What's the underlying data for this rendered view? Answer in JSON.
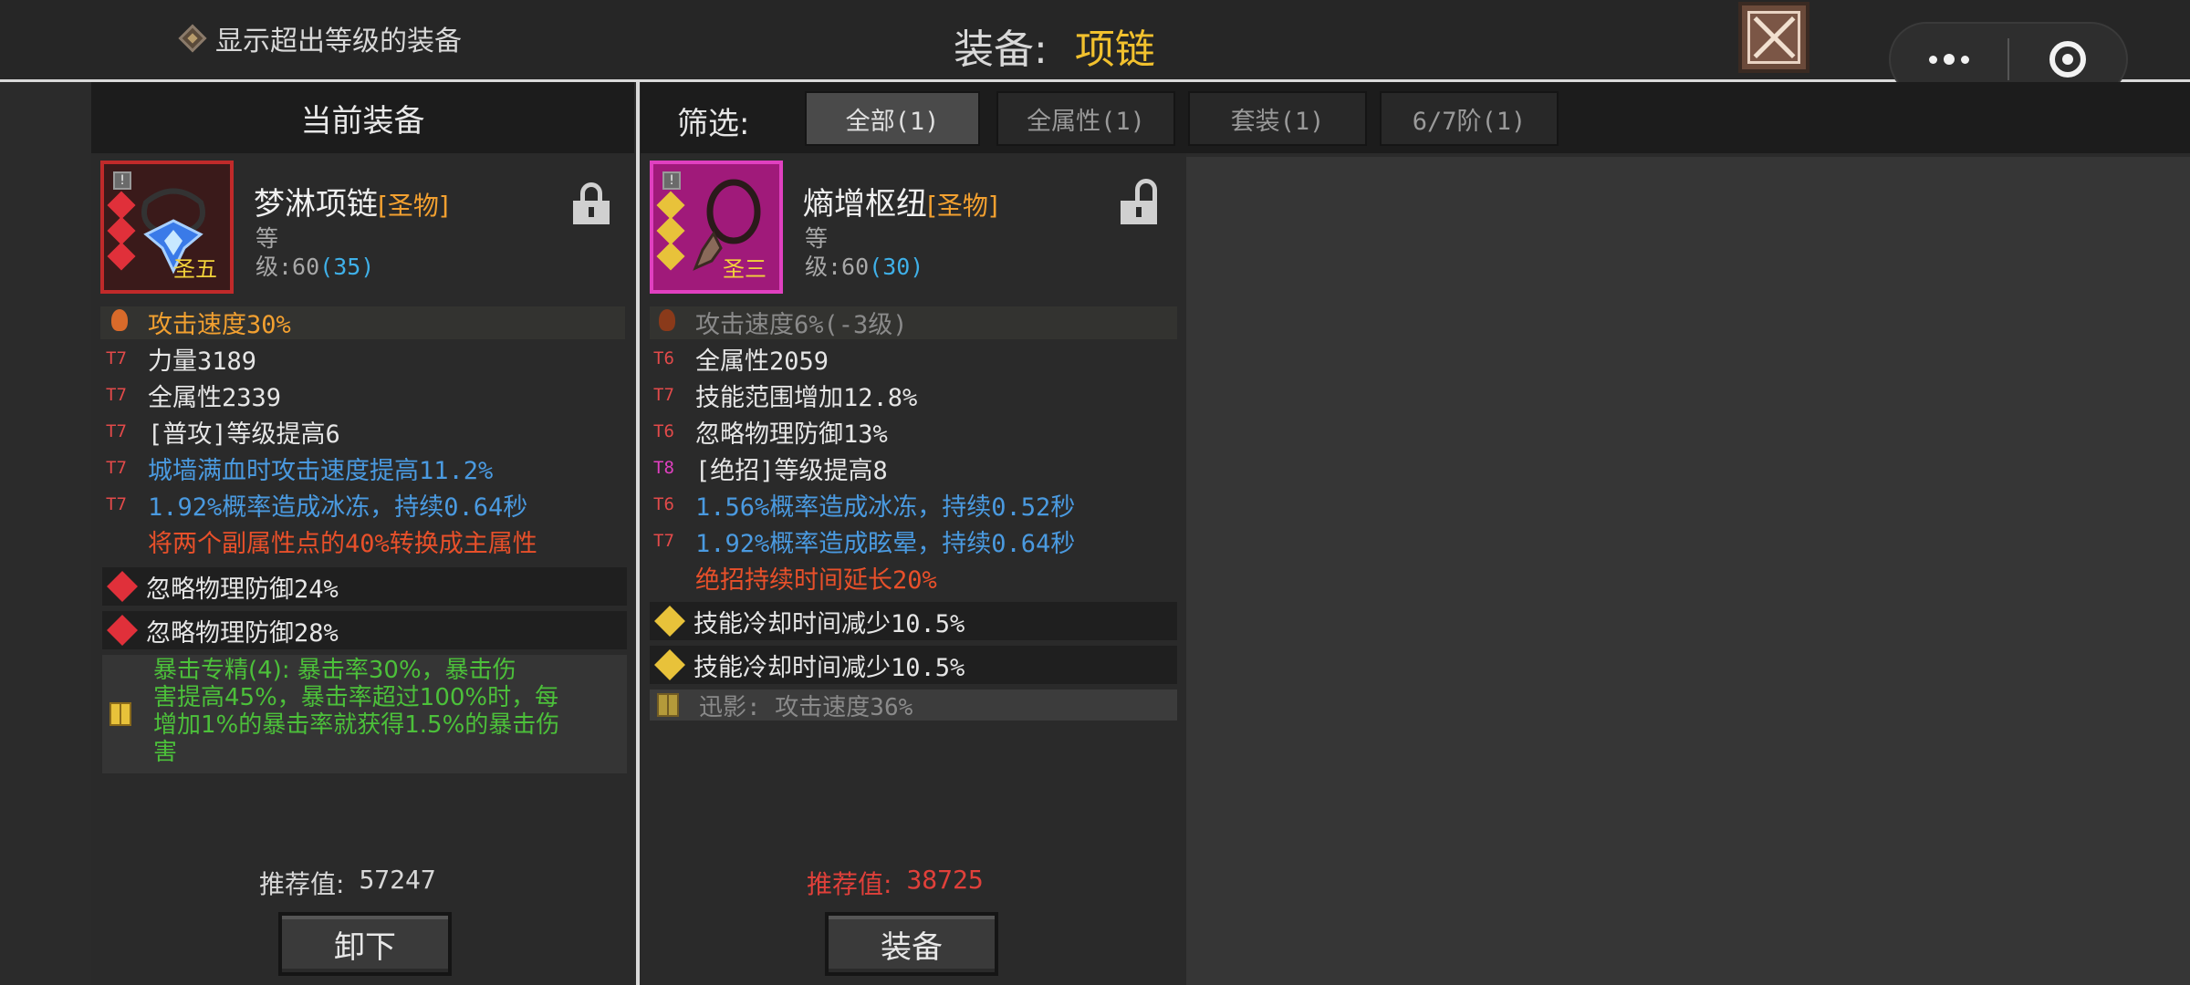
{
  "topbar": {
    "show_over_level_label": "显示超出等级的装备",
    "title_label": "装备:",
    "title_value": "项链"
  },
  "left": {
    "header": "当前装备",
    "item": {
      "name": "梦淋项链",
      "quality": "[圣物]",
      "level_prefix_1": "等",
      "level_prefix_2": "级:60",
      "level_extra": "(35)",
      "rank": "圣五"
    },
    "attrs": [
      {
        "tier": "",
        "text": "攻击速度30%",
        "color": "#f2a030"
      },
      {
        "tier": "T7",
        "text": "力量3189",
        "color": "#e6e6e6"
      },
      {
        "tier": "T7",
        "text": "全属性2339",
        "color": "#e6e6e6"
      },
      {
        "tier": "T7",
        "text": "[普攻]等级提高6",
        "color": "#e6e6e6"
      },
      {
        "tier": "T7",
        "text": "城墙满血时攻击速度提高11.2%",
        "color": "#4a9ae0"
      },
      {
        "tier": "T7",
        "text": "1.92%概率造成冰冻，持续0.64秒",
        "color": "#4a9ae0"
      },
      {
        "tier": "",
        "text": "将两个副属性点的40%转换成主属性",
        "color": "#e8502a"
      }
    ],
    "gems": [
      "忽略物理防御24%",
      "忽略物理防御28%"
    ],
    "set_bonus": [
      "暴击专精(4): 暴击率30%，暴击伤",
      "害提高45%，暴击率超过100%时，每",
      "增加1%的暴击率就获得1.5%的暴击伤",
      "害"
    ],
    "score_label": "推荐值:",
    "score_value": "57247",
    "button": "卸下"
  },
  "middle": {
    "filter_label": "筛选:",
    "filters": [
      "全部(1)",
      "全属性(1)",
      "套装(1)",
      "6/7阶(1)"
    ],
    "item": {
      "name": "熵增枢纽",
      "quality": "[圣物]",
      "level_prefix_1": "等",
      "level_prefix_2": "级:60",
      "level_extra": "(30)",
      "rank": "圣三"
    },
    "attrs": [
      {
        "tier": "",
        "text": "攻击速度6%(-3级)",
        "color": "#8a8a8a"
      },
      {
        "tier": "T6",
        "text": "全属性2059",
        "color": "#e6e6e6"
      },
      {
        "tier": "T7",
        "text": "技能范围增加12.8%",
        "color": "#e6e6e6"
      },
      {
        "tier": "T6",
        "text": "忽略物理防御13%",
        "color": "#e6e6e6"
      },
      {
        "tier": "T8",
        "text": "[绝招]等级提高8",
        "color": "#e6e6e6"
      },
      {
        "tier": "T6",
        "text": "1.56%概率造成冰冻，持续0.52秒",
        "color": "#4a9ae0"
      },
      {
        "tier": "T7",
        "text": "1.92%概率造成眩晕，持续0.64秒",
        "color": "#4a9ae0"
      },
      {
        "tier": "",
        "text": "绝招持续时间延长20%",
        "color": "#e8502a"
      }
    ],
    "gems": [
      "技能冷却时间减少10.5%",
      "技能冷却时间减少10.5%"
    ],
    "set_bonus": "迅影: 攻击速度36%",
    "score_label": "推荐值:",
    "score_value": "38725",
    "button": "装备"
  },
  "colors": {
    "accent_gold": "#f2c12e",
    "score_red": "#e0403a",
    "orange": "#f2a030"
  }
}
